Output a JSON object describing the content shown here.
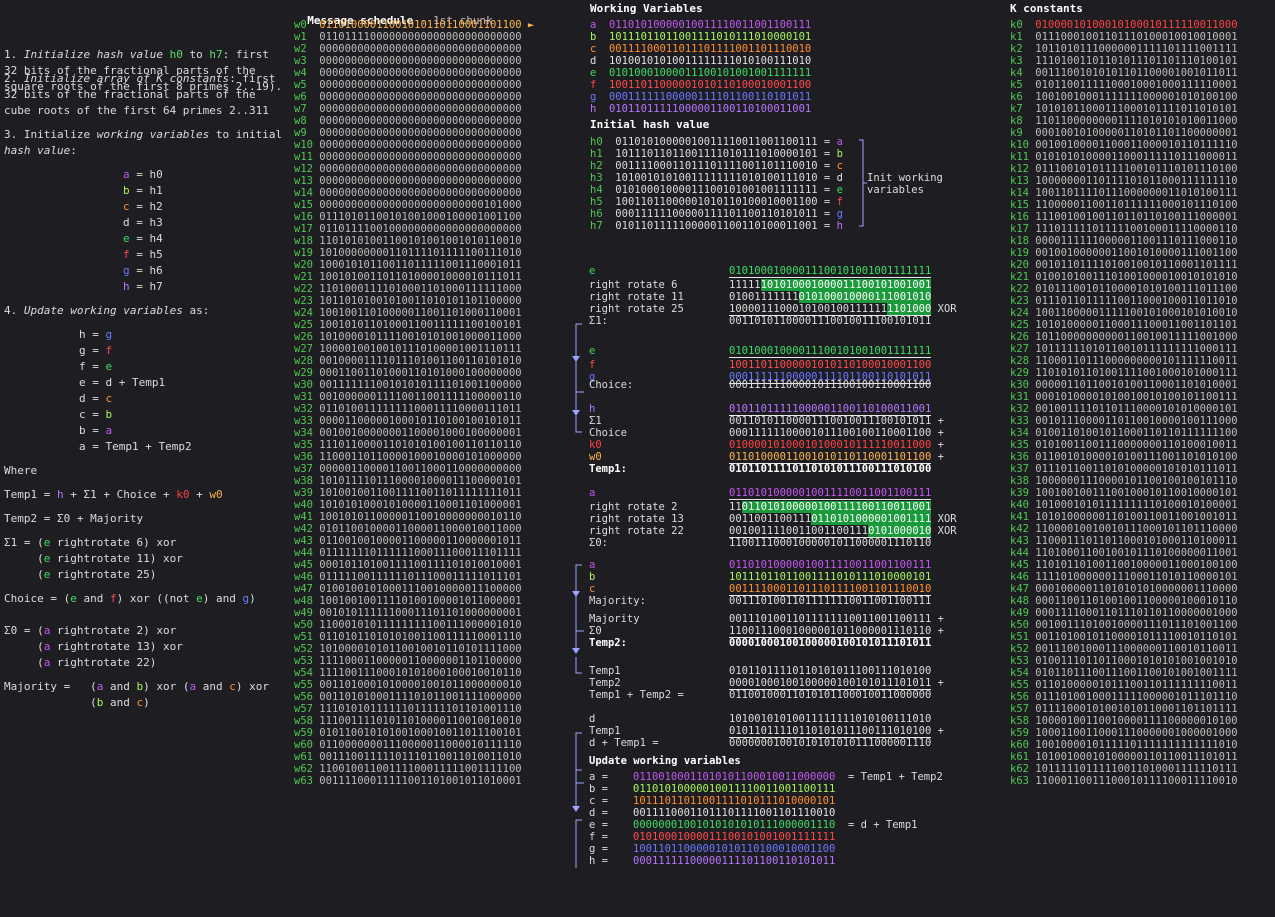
{
  "steps": {
    "s1": "1. Initialize hash value h0 to h7: first\n32 bits of the fractional parts of the\nsquare roots of the first 8 primes 2..19).",
    "s2": "2. Initialize array of K constants: first\n32 bits of the fractional parts of the\ncube roots of the first 64 primes 2..311",
    "s3": "3. Initialize working variables to initial\nhash value:",
    "assign3": [
      [
        "a",
        "h0"
      ],
      [
        "b",
        "h1"
      ],
      [
        "c",
        "h2"
      ],
      [
        "d",
        "h3"
      ],
      [
        "e",
        "h4"
      ],
      [
        "f",
        "h5"
      ],
      [
        "g",
        "h6"
      ],
      [
        "h",
        "h7"
      ]
    ],
    "s4": "4. Update working variables as:",
    "update": [
      "h = g",
      "g = f",
      "f = e",
      "e = d + Temp1",
      "d = c",
      "c = b",
      "b = a",
      "a = Temp1 + Temp2"
    ],
    "where": "Where",
    "temp1": "Temp1 = h + Σ1 + Choice + k0 + w0",
    "temp2": "Temp2 = Σ0 + Majority",
    "sigma1": [
      "Σ1 = (e rightrotate 6) xor",
      "     (e rightrotate 11) xor",
      "     (e rightrotate 25)"
    ],
    "choice": "Choice = (e and f) xor ((not e) and g)",
    "sigma0": [
      "Σ0 = (a rightrotate 2) xor",
      "     (a rightrotate 13) xor",
      "     (a rightrotate 22)"
    ],
    "majority": [
      "Majority =   (a and b) xor (a and c) xor",
      "             (b and c)"
    ]
  },
  "schedule": {
    "title": "Message schedule",
    "subtitle": " - 1st chunk",
    "rows": [
      "01101000011001010110110001101100",
      "01101111000000000000000000000000",
      "00000000000000000000000000000000",
      "00000000000000000000000000000000",
      "00000000000000000000000000000000",
      "00000000000000000000000000000000",
      "00000000000000000000000000000000",
      "00000000000000000000000000000000",
      "00000000000000000000000000000000",
      "00000000000000000000000000000000",
      "00000000000000000000000000000000",
      "00000000000000000000000000000000",
      "00000000000000000000000000000000",
      "00000000000000000000000000000000",
      "00000000000000000000000000000000",
      "00000000000000000000000000101000",
      "01110101100101001000100001001100",
      "01101111001000000000000000000000",
      "11010101001100101001001010110010",
      "10100000000110111101111100111010",
      "10001010110011011111001110001011",
      "10010100110110100001000010111011",
      "11010001111010001101000111111000",
      "10110101001010011010101101100000",
      "10010011010000011001101000110001",
      "10010101101000110011111100100101",
      "10100001011110010101001000011000",
      "10000100100101110100001001110111",
      "00100001111011101001100110101010",
      "00011001101000110101000100000000",
      "00111111100101010111101001100000",
      "00100000011110011001111100000110",
      "01101001111111100011110000111011",
      "00001100000100010110100100101011",
      "00100100000001100001000100000001",
      "11101100001101010100100110110110",
      "11000110110000100010000101000000",
      "00000110000110011000110000000000",
      "10101111011100001000011100000101",
      "10100100110011110011011111111011",
      "10101010001010000110001101000001",
      "10010101100000110010000000010110",
      "01011001000011000011000010011000",
      "01100100100001100000110000001011",
      "01111111011111100011100011101111",
      "00010110100111100111101010010001",
      "01111100111111011100011111011101",
      "01001001010001110010000011100000",
      "10010010011110100100001011000001",
      "00101011111100011101101000000001",
      "11000101011111111100111000001010",
      "01101011010101001100111110001110",
      "10100001010110010010110101111000",
      "11110001100000110000001101100000",
      "11110011100010101000100010010110",
      "00110100010100001001011000000010",
      "00110101000111101011001111000000",
      "11101010111111011111101101001110",
      "11100111101011010000110010010010",
      "01011001010100100010011011100101",
      "01100000001110000011000010111110",
      "00111001111101110110011010011010",
      "11001001100111100011111001111100",
      "00111100011111001101001011010001"
    ]
  },
  "working": {
    "title": "Working Variables",
    "rows": [
      [
        "a",
        "01101010000010011110011001100111"
      ],
      [
        "b",
        "10111011011001111010111010000101"
      ],
      [
        "c",
        "00111100011011101111001101110010"
      ],
      [
        "d",
        "10100101010011111111010100111010"
      ],
      [
        "e",
        "01010001000011100101001001111111"
      ],
      [
        "f",
        "10011011000001010110100010001100"
      ],
      [
        "g",
        "00011111100000111101100110101011"
      ],
      [
        "h",
        "01011011111000001100110100011001"
      ]
    ]
  },
  "initial": {
    "title": "Initial hash value",
    "rows": [
      [
        "h0",
        "01101010000010011110011001100111",
        "a"
      ],
      [
        "h1",
        "10111011011001111010111010000101",
        "b"
      ],
      [
        "h2",
        "00111100011011101111001101110010",
        "c"
      ],
      [
        "h3",
        "10100101010011111111010100111010",
        "d"
      ],
      [
        "h4",
        "01010001000011100101001001111111",
        "e"
      ],
      [
        "h5",
        "10011011000001010110100010001100",
        "f"
      ],
      [
        "h6",
        "00011111100000111101100110101011",
        "g"
      ],
      [
        "h7",
        "01011011111000001100110100011001",
        "h"
      ]
    ],
    "note": "Init working\nvariables"
  },
  "kconst": {
    "title": "K constants",
    "rows": [
      "01000010100010100010111110011000",
      "01110001001101110100010010010001",
      "10110101110000001111101111001111",
      "11101001101101011101101110100101",
      "00111001010101101100001001011011",
      "01011001111100010001000111110001",
      "10010010001111111000001010100100",
      "10101011000111000101111011010101",
      "11011000000001111010101010011000",
      "00010010100000110101101100000001",
      "00100100001100011000010110111110",
      "01010101000011000111110111000011",
      "01110010101111100101110101110100",
      "10000000110111101011000111111110",
      "10011011110111000000011010100111",
      "11000001100110111111000101110100",
      "11100100100110110110100111000001",
      "11101111101111100100011110000110",
      "00001111110000011001110111000110",
      "00100100000011001010000111001100",
      "00101101111010010010110001101111",
      "01001010011101001000010010101010",
      "01011100101100001010100111011100",
      "01110110111110011000100011011010",
      "10011000001111100101000101010010",
      "10101000001100011100011001101101",
      "10110000000000110010011111001000",
      "10111111010110010111111111000111",
      "11000110111000000000101111110011",
      "11010101101001111001000101000111",
      "00000110110010100110001101010001",
      "00010100001010010010100101100111",
      "00100111101101110000101010000101",
      "00101110000110110010000100111000",
      "01001101001011000110110111111100",
      "01010011001110000000110100010011",
      "01100101000010100111001101010100",
      "01110110011010100000101010111011",
      "10000001110000101100100100101110",
      "10010010011100100010110010000101",
      "10100010101111111110100010100001",
      "10101000000110100110011001001011",
      "11000010010010111000101101110000",
      "11000111011011000101000110100011",
      "11010001100100101110100000011001",
      "11010110100110010000011000100100",
      "11110100000011100011010110000101",
      "00010000011010101010000001110000",
      "00011001101001001100000100010110",
      "00011110001101110110110000001000",
      "00100111010010000111011101001100",
      "00110100101100001011110010110101",
      "00111001000111000000110010110011",
      "01001110110110001010101001001010",
      "01011011100111001100101001001111",
      "01101000001011100110111111110011",
      "01110100100011111000001011101110",
      "01111000101001010110001101101111",
      "10000100110010000111100000010100",
      "10001100110001110000001000001000",
      "10010000101111101111111111111010",
      "10100100010100000110110011101011",
      "10111110111110011010001111110111",
      "11000110011100010111100011110010"
    ]
  },
  "calc": {
    "e_label": "e",
    "e_val": "01010001000011100101001001111111",
    "rr6": "right rotate 6",
    "rr11": "right rotate 11",
    "rr25": "right rotate 25",
    "xor": "XOR",
    "rr6_val": "11111101010001000011100101001001",
    "rr11_val": "01001111111010100010000111001010",
    "rr25_val": "10000111000101001001111111101000",
    "s1_label": "Σ1:",
    "s1_val": "00110101100001110010011100101011",
    "ch_e": "01010001000011100101001001111111",
    "ch_f": "10011011000001010110100010001100",
    "ch_g": "00011111100000111101100110101011",
    "ch_label": "Choice:",
    "ch_val": "00011111100001011100100110001100",
    "t1_h": "01011011111000001100110100011001",
    "t1_s1": "00110101100001110010011100101011",
    "t1_ch": "00011111100001011100100110001100",
    "t1_k0": "01000010100010100010111110011000",
    "t1_w0": "01101000011001010110110001101100",
    "t1_label": "Temp1:",
    "t1_val": "01011011110110101011100111010100",
    "a_val": "01101010000010011110011001100111",
    "rr2": "right rotate 2",
    "rr13": "right rotate 13",
    "rr22": "right rotate 22",
    "rr2_val": "11011010100000100111100110011001",
    "rr13_val": "00110011001110110101000001001111",
    "rr22_val": "00100111100110011001110101000010",
    "s0_label": "Σ0:",
    "s0_val": "11001110001000001011000001110110",
    "mj_a": "01101010000010011110011001100111",
    "mj_b": "10111011011001111010111010000101",
    "mj_c": "00111100011011101111001101110010",
    "mj_label": "Majority:",
    "mj_val": "00111010011011111110011001100111",
    "t2_mj": "00111010011011111110011001100111",
    "t2_s0": "11001110001000001011000001110110",
    "t2_label": "Temp2:",
    "t2_val": "00001000100100000100101011101011",
    "tt_t1": "01011011110110101011100111010100",
    "tt_t2": "00001000100100000100101011101011",
    "tt_label": "Temp1 + Temp2 =",
    "tt_val": "01100100011010101100010011000000",
    "dt_d": "10100101010011111111010100111010",
    "dt_t1": "01011011110110101011100111010100",
    "dt_label": "d + Temp1 =",
    "dt_val": "00000001001010101010111000001110",
    "upd_title": "Update working variables",
    "upd": [
      [
        "a",
        "01100100011010101100010011000000",
        "= Temp1 + Temp2"
      ],
      [
        "b",
        "01101010000010011110011001100111",
        ""
      ],
      [
        "c",
        "10111011011001111010111010000101",
        ""
      ],
      [
        "d",
        "00111100011011101111001101110010",
        ""
      ],
      [
        "e",
        "00000001001010101010111000001110",
        "= d + Temp1"
      ],
      [
        "f",
        "01010001000011100101001001111111",
        ""
      ],
      [
        "g",
        "10011011000001010110100010001100",
        ""
      ],
      [
        "h",
        "00011111100000111101100110101011",
        ""
      ]
    ]
  }
}
